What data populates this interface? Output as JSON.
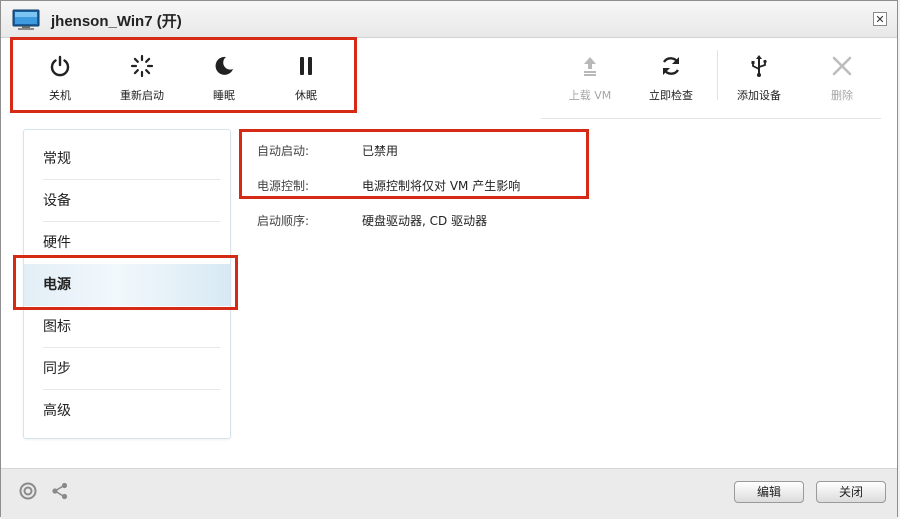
{
  "window": {
    "title": "jhenson_Win7 (开)",
    "close_glyph": "✕"
  },
  "toolbar": {
    "left": [
      {
        "label": "关机",
        "icon": "power-icon"
      },
      {
        "label": "重新启动",
        "icon": "restart-icon"
      },
      {
        "label": "睡眠",
        "icon": "sleep-icon"
      },
      {
        "label": "休眠",
        "icon": "pause-icon"
      }
    ],
    "right": [
      {
        "label": "上载 VM",
        "icon": "upload-icon",
        "enabled": false
      },
      {
        "label": "立即检查",
        "icon": "refresh-icon",
        "enabled": true
      },
      {
        "label": "添加设备",
        "icon": "usb-icon",
        "enabled": true
      },
      {
        "label": "删除",
        "icon": "delete-icon",
        "enabled": false
      }
    ]
  },
  "sidebar": {
    "items": [
      {
        "label": "常规"
      },
      {
        "label": "设备"
      },
      {
        "label": "硬件"
      },
      {
        "label": "电源",
        "selected": true
      },
      {
        "label": "图标"
      },
      {
        "label": "同步"
      },
      {
        "label": "高级"
      }
    ]
  },
  "power": {
    "autostart_label": "自动启动:",
    "autostart_value": "已禁用",
    "power_control_label": "电源控制:",
    "power_control_value": "电源控制将仅对 VM 产生影响",
    "boot_order_label": "启动顺序:",
    "boot_order_value": "硬盘驱动器, CD 驱动器"
  },
  "footer": {
    "edit_label": "编辑",
    "close_label": "关闭",
    "left_icons": [
      "help-icon",
      "share-icon"
    ]
  },
  "colors": {
    "annotation": "#d42a16",
    "selected_bg": "#e2eef6"
  }
}
